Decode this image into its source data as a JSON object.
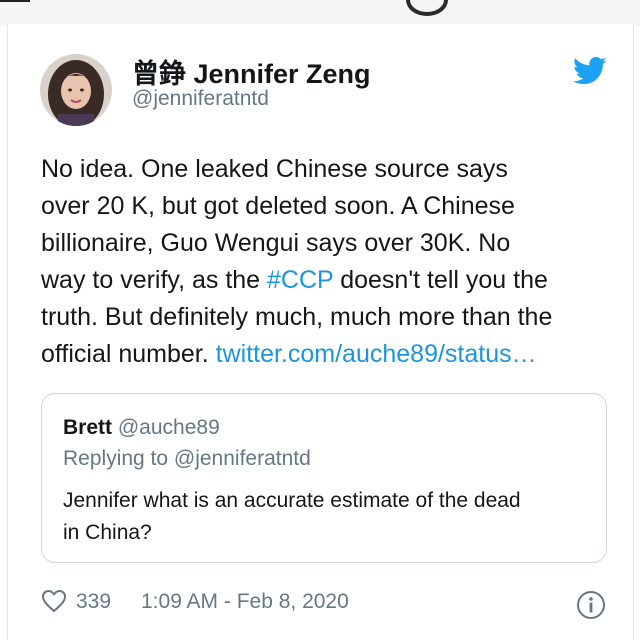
{
  "tweet": {
    "author_name": "曾錚 Jennifer Zeng",
    "author_handle": "@jenniferatntd",
    "text_lines": [
      "No idea. One leaked Chinese source says",
      "over 20 K, but got deleted soon. A Chinese",
      "billionaire, Guo Wengui says over 30K. No"
    ],
    "line4_before": "way to verify, as the ",
    "hashtag": "#CCP",
    "line4_after": " doesn't tell you the",
    "line5": "truth. But definitely much, much more than the",
    "line6_before": "official number. ",
    "link_text": "twitter.com/auche89/status…",
    "likes": "339",
    "timestamp": "1:09 AM - Feb 8, 2020"
  },
  "quoted": {
    "name": "Brett",
    "handle": "@auche89",
    "replying_to": "Replying to @jenniferatntd",
    "text_line1": "Jennifer what is an accurate estimate of the dead",
    "text_line2": "in China?"
  },
  "colors": {
    "link": "#1b95e0",
    "secondary_text": "#657786",
    "primary_text": "#14171a",
    "twitter_blue": "#1da1f2"
  },
  "icons": [
    "twitter-bird-icon",
    "heart-icon",
    "info-icon"
  ]
}
